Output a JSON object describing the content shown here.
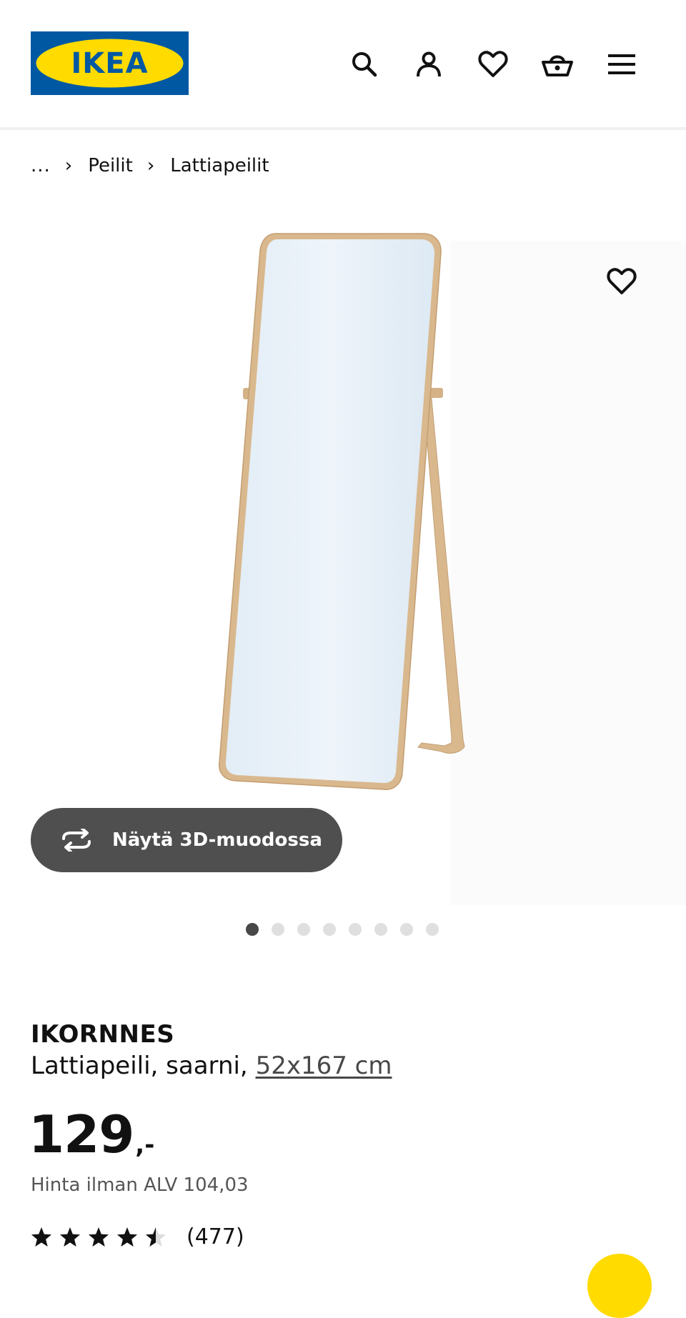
{
  "header": {
    "logo_text": "IKEA",
    "icons": [
      "search-icon",
      "user-icon",
      "heart-icon",
      "basket-icon",
      "menu-icon"
    ]
  },
  "breadcrumb": {
    "ellipsis": "...",
    "items": [
      "Peilit",
      "Lattiapeilit"
    ]
  },
  "gallery": {
    "view_3d_label": "Näytä 3D-muodossa",
    "image_count": 8,
    "active_index": 0
  },
  "product": {
    "name": "IKORNNES",
    "description": "Lattiapeili, saarni, ",
    "dimensions": "52x167 cm",
    "price_integer": "129",
    "price_suffix": ",-",
    "vat_text": "Hinta ilman ALV 104,03",
    "rating_value": 4.5,
    "rating_max": 5,
    "review_count": "(477)"
  },
  "colors": {
    "brand_blue": "#0058a3",
    "brand_yellow": "#ffdb00",
    "frame_wood": "#d9b88e"
  }
}
